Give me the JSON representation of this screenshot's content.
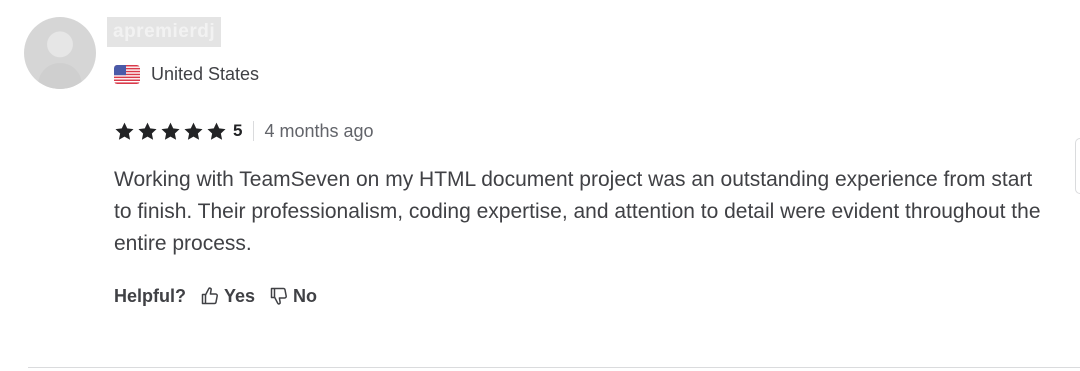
{
  "review": {
    "username": "apremierdj",
    "country": "United States",
    "flag_icon": "us-flag-icon",
    "rating": {
      "stars_filled": 5,
      "stars_total": 5,
      "score_label": "5",
      "star_color": "#222325"
    },
    "time_ago": "4 months ago",
    "text": "Working with TeamSeven on my HTML document project was an outstanding experience from start to finish. Their professionalism, coding expertise, and attention to detail were evident throughout the entire process.",
    "helpful": {
      "label": "Helpful?",
      "yes_label": "Yes",
      "no_label": "No",
      "yes_icon": "thumbs-up-icon",
      "no_icon": "thumbs-down-icon"
    }
  }
}
